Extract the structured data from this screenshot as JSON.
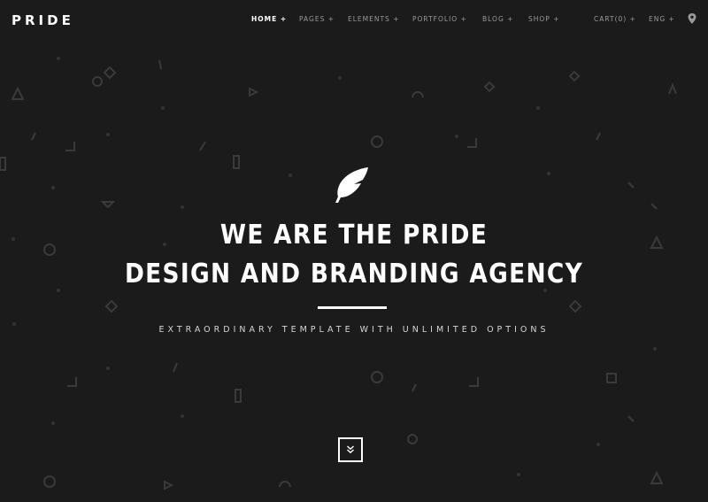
{
  "header": {
    "logo": "PRIDE",
    "nav": [
      {
        "label": "HOME +"
      },
      {
        "label": "PAGES +"
      },
      {
        "label": "ELEMENTS +"
      },
      {
        "label": "PORTFOLIO +"
      },
      {
        "label": "BLOG +"
      },
      {
        "label": "SHOP +"
      },
      {
        "label": "CART(0) +"
      },
      {
        "label": "ENG +"
      }
    ],
    "location_icon": "map-pin-icon"
  },
  "hero": {
    "icon": "feather-icon",
    "title_line1": "WE ARE THE PRIDE",
    "title_line2": "DESIGN AND BRANDING AGENCY",
    "subtitle": "EXTRAORDINARY TEMPLATE WITH UNLIMITED OPTIONS",
    "scroll_icon": "double-chevron-down-icon"
  },
  "colors": {
    "background": "#1b1b1c",
    "text": "#ffffff",
    "nav_text": "#9a9a9a",
    "pattern": "#3a3a3c"
  }
}
